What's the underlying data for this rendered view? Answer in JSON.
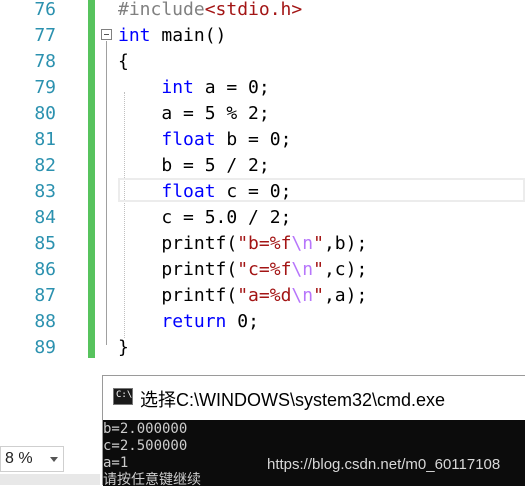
{
  "editor": {
    "line_numbers": [
      "76",
      "77",
      "78",
      "79",
      "80",
      "81",
      "82",
      "83",
      "84",
      "85",
      "86",
      "87",
      "88",
      "89"
    ],
    "lines": [
      {
        "segments": [
          {
            "t": "#include",
            "c": "pp"
          },
          {
            "t": "<stdio.h>",
            "c": "inc"
          }
        ]
      },
      {
        "segments": [
          {
            "t": "int",
            "c": "kw"
          },
          {
            "t": " main()",
            "c": ""
          }
        ]
      },
      {
        "segments": [
          {
            "t": "{",
            "c": ""
          }
        ]
      },
      {
        "segments": [
          {
            "t": "    ",
            "c": ""
          },
          {
            "t": "int",
            "c": "kw"
          },
          {
            "t": " a = 0;",
            "c": ""
          }
        ]
      },
      {
        "segments": [
          {
            "t": "    a = 5 % 2;",
            "c": ""
          }
        ]
      },
      {
        "segments": [
          {
            "t": "    ",
            "c": ""
          },
          {
            "t": "float",
            "c": "kw"
          },
          {
            "t": " b = 0;",
            "c": ""
          }
        ]
      },
      {
        "segments": [
          {
            "t": "    b = 5 / 2;",
            "c": ""
          }
        ]
      },
      {
        "segments": [
          {
            "t": "    ",
            "c": ""
          },
          {
            "t": "float",
            "c": "kw"
          },
          {
            "t": " c = 0;",
            "c": ""
          }
        ]
      },
      {
        "segments": [
          {
            "t": "    c = 5.0 / 2;",
            "c": ""
          }
        ]
      },
      {
        "segments": [
          {
            "t": "    printf(",
            "c": ""
          },
          {
            "t": "\"b=%f",
            "c": "str"
          },
          {
            "t": "\\n",
            "c": "esc"
          },
          {
            "t": "\"",
            "c": "str"
          },
          {
            "t": ",b);",
            "c": ""
          }
        ]
      },
      {
        "segments": [
          {
            "t": "    printf(",
            "c": ""
          },
          {
            "t": "\"c=%f",
            "c": "str"
          },
          {
            "t": "\\n",
            "c": "esc"
          },
          {
            "t": "\"",
            "c": "str"
          },
          {
            "t": ",c);",
            "c": ""
          }
        ]
      },
      {
        "segments": [
          {
            "t": "    printf(",
            "c": ""
          },
          {
            "t": "\"a=%d",
            "c": "str"
          },
          {
            "t": "\\n",
            "c": "esc"
          },
          {
            "t": "\"",
            "c": "str"
          },
          {
            "t": ",a);",
            "c": ""
          }
        ]
      },
      {
        "segments": [
          {
            "t": "    ",
            "c": ""
          },
          {
            "t": "return",
            "c": "kw"
          },
          {
            "t": " 0;",
            "c": ""
          }
        ]
      },
      {
        "segments": [
          {
            "t": "}",
            "c": ""
          }
        ]
      }
    ]
  },
  "zoom": {
    "value": "8 %"
  },
  "cmd": {
    "title": "选择C:\\WINDOWS\\system32\\cmd.exe",
    "icon_label": "C:\\",
    "output": [
      "b=2.000000",
      "c=2.500000",
      "a=1",
      "请按任意键继续"
    ]
  },
  "watermark": "https://blog.csdn.net/m0_60117108",
  "colors": {
    "keyword": "#0000ff",
    "string": "#a31515",
    "escape": "#b776fb",
    "line_number": "#2b91af",
    "change_bar": "#57c35d"
  }
}
